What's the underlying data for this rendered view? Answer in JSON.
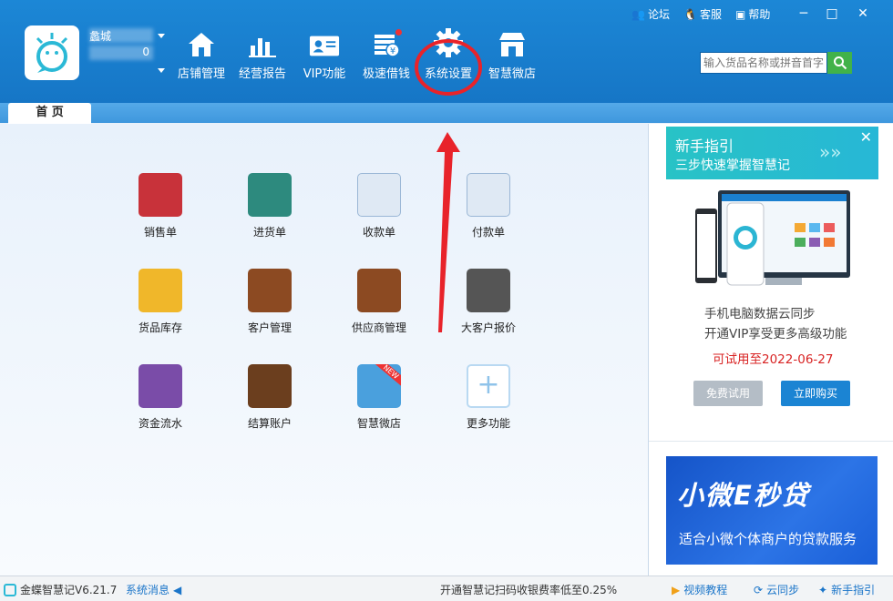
{
  "user": {
    "name": "蠡城",
    "phone": "0"
  },
  "top_links": [
    {
      "label": "论坛",
      "icon": "forum-icon"
    },
    {
      "label": "客服",
      "icon": "service-icon"
    },
    {
      "label": "帮助",
      "icon": "help-icon"
    }
  ],
  "window": {
    "minimize": "─",
    "maximize": "□",
    "close": "✕"
  },
  "nav": [
    {
      "label": "店铺管理",
      "icon": "store-icon"
    },
    {
      "label": "经营报告",
      "icon": "report-icon"
    },
    {
      "label": "VIP功能",
      "icon": "vip-card-icon"
    },
    {
      "label": "极速借钱",
      "icon": "loan-icon"
    },
    {
      "label": "系统设置",
      "icon": "gear-icon"
    },
    {
      "label": "智慧微店",
      "icon": "shop-icon"
    }
  ],
  "search": {
    "placeholder": "输入货品名称或拼音首字母"
  },
  "tabs": [
    {
      "label": "首 页"
    }
  ],
  "apps": [
    {
      "label": "销售单",
      "icon": "sales-order-icon",
      "color": "#c8323a"
    },
    {
      "label": "进货单",
      "icon": "purchase-order-icon",
      "color": "#2d8a7e"
    },
    {
      "label": "收款单",
      "icon": "receipt-icon",
      "color": "#3a7fc2"
    },
    {
      "label": "付款单",
      "icon": "payment-icon",
      "color": "#3a9b4a"
    },
    {
      "label": "货品库存",
      "icon": "inventory-icon",
      "color": "#e9a619"
    },
    {
      "label": "客户管理",
      "icon": "customer-icon",
      "color": "#8c4a22"
    },
    {
      "label": "供应商管理",
      "icon": "supplier-icon",
      "color": "#8c4a22"
    },
    {
      "label": "大客户报价",
      "icon": "quote-tag-icon",
      "color": "#555"
    },
    {
      "label": "资金流水",
      "icon": "money-flow-icon",
      "color": "#7a4ca8"
    },
    {
      "label": "结算账户",
      "icon": "account-book-icon",
      "color": "#6b3e1e"
    },
    {
      "label": "智慧微店",
      "icon": "micro-shop-icon",
      "color": "#4aa0dd"
    },
    {
      "label": "更多功能",
      "icon": "plus-icon",
      "color": "#8fc3ea"
    }
  ],
  "new_badge": "NEW",
  "guide": {
    "title": "新手指引",
    "subtitle": "三步快速掌握智慧记"
  },
  "promo": {
    "line1": "手机电脑数据云同步",
    "line2": "开通VIP享受更多高级功能",
    "trial": "可试用至2022-06-27",
    "free_btn": "免费试用",
    "buy_btn": "立即购买"
  },
  "ad": {
    "title": "小微E秒贷",
    "subtitle": "适合小微个体商户的贷款服务"
  },
  "status": {
    "app": "金蝶智慧记V6.21.7",
    "message": "系统消息",
    "notice": "开通智慧记扫码收银费率低至0.25%",
    "video": "视频教程",
    "cloud": "云同步",
    "guide": "新手指引"
  },
  "colors": {
    "header": "#1a80d0",
    "accent": "#1b84d3",
    "annotation": "#e8232a"
  }
}
